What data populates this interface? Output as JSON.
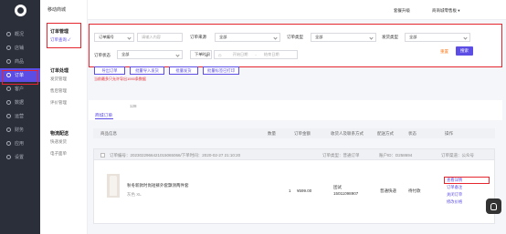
{
  "rail": {
    "items": [
      {
        "label": "概况",
        "icon": "home-icon"
      },
      {
        "label": "店铺",
        "icon": "shop-icon"
      },
      {
        "label": "商品",
        "icon": "goods-icon"
      },
      {
        "label": "订单",
        "icon": "order-icon",
        "active": true
      },
      {
        "label": "客户",
        "icon": "user-icon"
      },
      {
        "label": "数据",
        "icon": "chart-icon"
      },
      {
        "label": "运营",
        "icon": "operate-icon"
      },
      {
        "label": "财务",
        "icon": "finance-icon"
      },
      {
        "label": "应用",
        "icon": "app-icon"
      },
      {
        "label": "设置",
        "icon": "settings-icon"
      }
    ]
  },
  "side": {
    "title": "移动商城",
    "group1": "订单管理",
    "group1_items": [
      "订单查询 ✓"
    ],
    "group2": "订单处理",
    "group2_items": [
      "发货管理",
      "售后管理",
      "评价管理"
    ],
    "group3": "物流配送",
    "group3_items": [
      "快递发货",
      "电子面单"
    ]
  },
  "topbar": {
    "upgrade": "套餐升级",
    "account": "商商城零售板 ▾"
  },
  "filters": {
    "order_no_label": "订单编号",
    "order_no_placeholder": "请输入内容",
    "order_source_label": "订单来源",
    "order_source_value": "全部",
    "order_type_label": "订单类型",
    "order_type_value": "全部",
    "ship_type_label": "发货类型",
    "ship_type_value": "全部",
    "order_status_label": "订单状态",
    "order_status_value": "全部",
    "time_label": "下单时间",
    "start_placeholder": "开始日期",
    "to": "-",
    "end_placeholder": "结束日期",
    "reset": "重置",
    "search": "搜索"
  },
  "actions": [
    "导出订单",
    "批量导入发货",
    "批量发货",
    "批量标签已打印"
  ],
  "hint": "当前最多只允许导出1000条数据",
  "tabs": {
    "active": "商城订单",
    "count": "128"
  },
  "table": {
    "headers": [
      "商品信息",
      "数量",
      "订单金额",
      "收货人及联系方式",
      "配送方式",
      "状态",
      "操作"
    ]
  },
  "order": {
    "meta": "订单编号：2023022966421015065066/下单时间：2020-02-27 21:10:20",
    "type": "订单类型：普通订单",
    "account": "账户ID：D258694",
    "store": "订单渠道：公众号",
    "product": "秋冬新款时尚短裤外套飘领两件套",
    "spec": "灰色 XL",
    "qty": "1",
    "amount": "¥599.00",
    "receiver": "团试",
    "phone": "15011098907",
    "delivery": "普通快递",
    "status": "待付款",
    "ops": [
      "查看详情",
      "订单备注",
      "关闭订单",
      "修改价格"
    ]
  }
}
